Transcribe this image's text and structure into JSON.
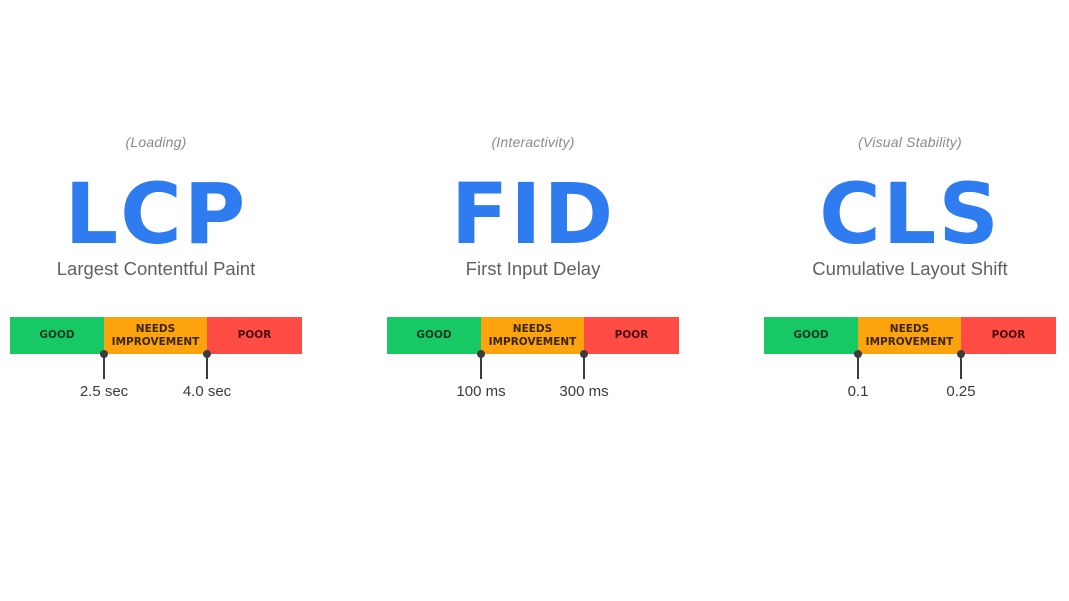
{
  "labels": {
    "good": "GOOD",
    "needs_improvement": "NEEDS IMPROVEMENT",
    "poor": "POOR"
  },
  "colors": {
    "accent_blue": "#2f7bf0",
    "good": "#17c964",
    "needs_improvement": "#fca30d",
    "poor": "#ff4d46"
  },
  "metrics": [
    {
      "category": "(Loading)",
      "acronym": "LCP",
      "name": "Largest Contentful Paint",
      "segments": [
        "GOOD",
        "NEEDS IMPROVEMENT",
        "POOR"
      ],
      "thresholds": [
        "2.5 sec",
        "4.0 sec"
      ]
    },
    {
      "category": "(Interactivity)",
      "acronym": "FID",
      "name": "First Input Delay",
      "segments": [
        "GOOD",
        "NEEDS IMPROVEMENT",
        "POOR"
      ],
      "thresholds": [
        "100 ms",
        "300 ms"
      ]
    },
    {
      "category": "(Visual Stability)",
      "acronym": "CLS",
      "name": "Cumulative Layout Shift",
      "segments": [
        "GOOD",
        "NEEDS IMPROVEMENT",
        "POOR"
      ],
      "thresholds": [
        "0.1",
        "0.25"
      ]
    }
  ]
}
